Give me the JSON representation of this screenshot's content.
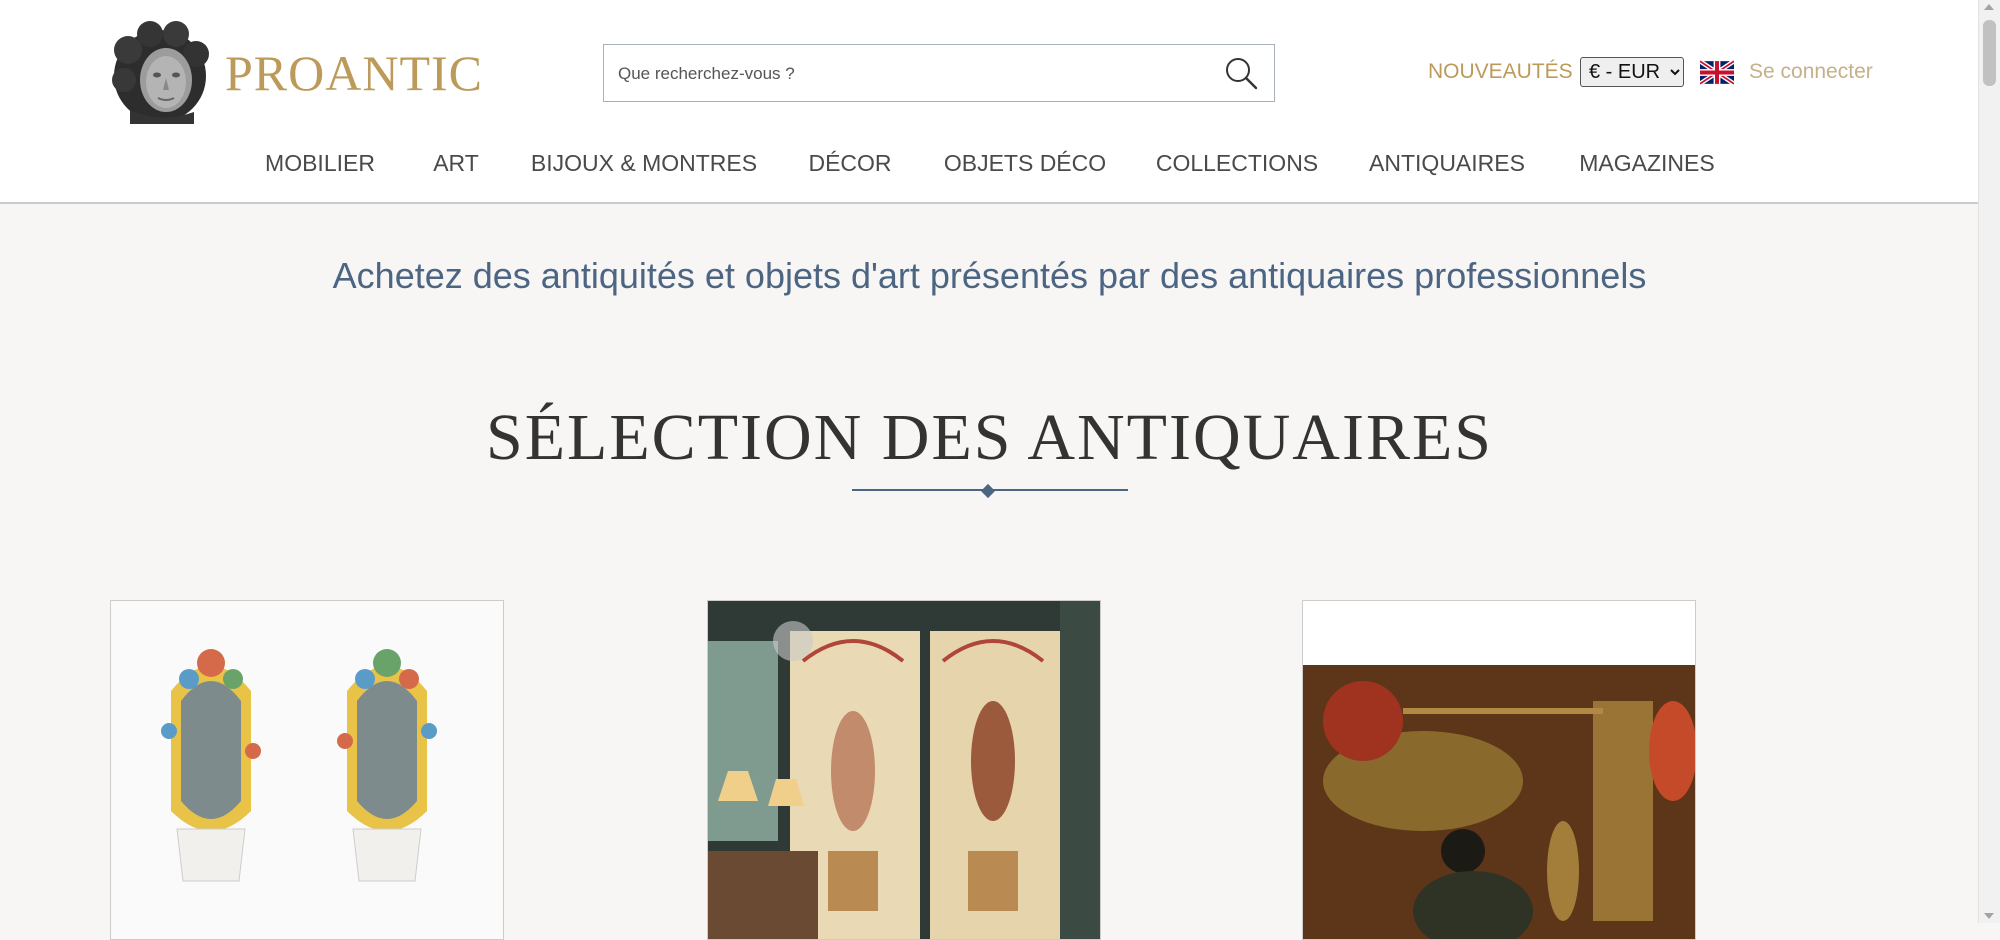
{
  "header": {
    "brand": "PROANTIC",
    "search": {
      "placeholder": "Que recherchez-vous ?"
    },
    "nouveautes": "NOUVEAUTÉS",
    "currency": {
      "selected": "€ - EUR"
    },
    "login": "Se connecter"
  },
  "nav": {
    "items": [
      {
        "label": "MOBILIER"
      },
      {
        "label": "ART"
      },
      {
        "label": "BIJOUX & MONTRES"
      },
      {
        "label": "DÉCOR"
      },
      {
        "label": "OBJETS DÉCO"
      },
      {
        "label": "COLLECTIONS"
      },
      {
        "label": "ANTIQUAIRES"
      },
      {
        "label": "MAGAZINES"
      }
    ]
  },
  "main": {
    "tagline": "Achetez des antiquités et objets d'art présentés par des antiquaires professionnels",
    "section_title": "SÉLECTION DES ANTIQUAIRES"
  },
  "colors": {
    "brand_gold": "#bc9a5a",
    "accent_blue": "#4b6582",
    "page_background": "#f7f6f4"
  },
  "icons": {
    "logo": "sculpture-head-logo",
    "search": "search-icon",
    "flag": "uk-flag-icon"
  }
}
